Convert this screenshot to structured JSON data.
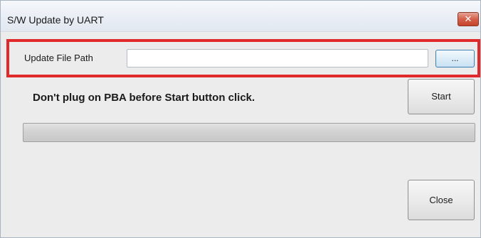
{
  "window": {
    "title": "S/W Update by UART",
    "close_glyph": "✕",
    "close_icon": "close-icon"
  },
  "file_path": {
    "label": "Update File Path",
    "value": "",
    "placeholder": "",
    "browse_label": "..."
  },
  "warning": "Don't plug on PBA before Start button click.",
  "start_label": "Start",
  "close_label": "Close",
  "progress": {
    "value": 0
  },
  "colors": {
    "highlight": "#e0292b",
    "close_button": "#c4432c",
    "browse_border": "#3c7fb1"
  }
}
